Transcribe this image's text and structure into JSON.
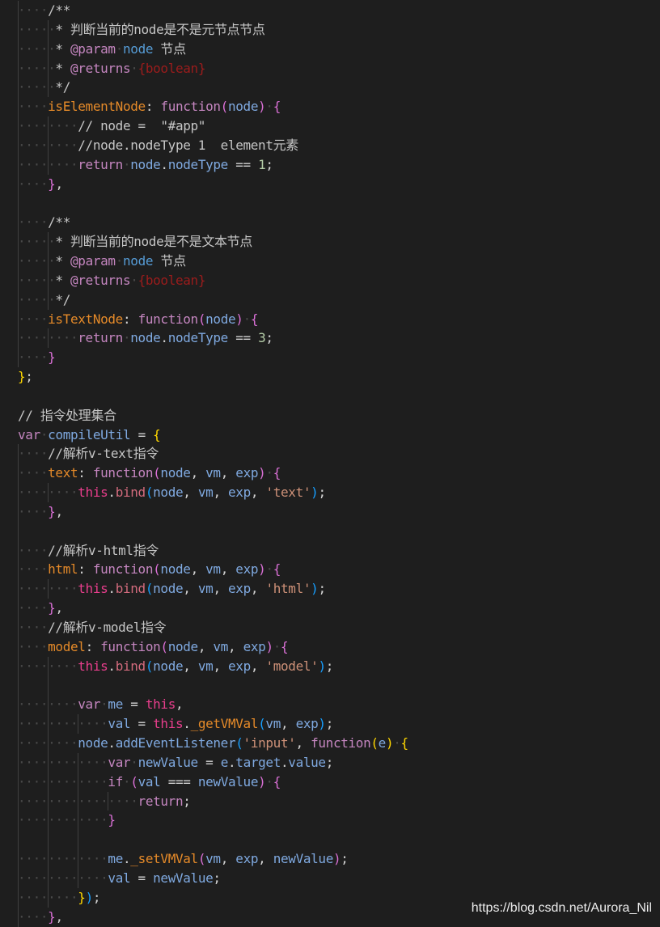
{
  "colors": {
    "background": "#1e1e1e",
    "comment": "#c6c6c6",
    "jsdoc_tag": "#c586c0",
    "jsdoc_type": "#9b1c1c",
    "param_name": "#569cd6",
    "property_key": "#e58a29",
    "keyword": "#c586c0",
    "function_kw": "#c586c0",
    "identifier": "#7fa9e0",
    "punct": "#d4d4d4",
    "number": "#b5cea8",
    "string": "#ce9178",
    "this": "#e83e8c",
    "method": "#d36b7d",
    "bracket_yellow": "#ffd700",
    "bracket_pink": "#da70d6",
    "bracket_blue": "#179fff",
    "whitespace": "#4a4a4a"
  },
  "lines": [
    [
      {
        "t": "    ",
        "c": "ws"
      },
      {
        "t": "/**",
        "c": "comment"
      }
    ],
    [
      {
        "t": "     ",
        "c": "ws"
      },
      {
        "t": "* 判断当前的node是不是元节点节点",
        "c": "comment"
      }
    ],
    [
      {
        "t": "     ",
        "c": "ws"
      },
      {
        "t": "* ",
        "c": "comment"
      },
      {
        "t": "@param",
        "c": "jsdoc_tag"
      },
      {
        "t": " ",
        "c": "ws"
      },
      {
        "t": "node",
        "c": "param_name"
      },
      {
        "t": " 节点",
        "c": "comment"
      }
    ],
    [
      {
        "t": "     ",
        "c": "ws"
      },
      {
        "t": "* ",
        "c": "comment"
      },
      {
        "t": "@returns",
        "c": "jsdoc_tag"
      },
      {
        "t": " ",
        "c": "ws"
      },
      {
        "t": "{boolean}",
        "c": "jsdoc_type"
      }
    ],
    [
      {
        "t": "     ",
        "c": "ws"
      },
      {
        "t": "*/",
        "c": "comment"
      }
    ],
    [
      {
        "t": "    ",
        "c": "ws"
      },
      {
        "t": "isElementNode",
        "c": "property_key"
      },
      {
        "t": ": ",
        "c": "punct"
      },
      {
        "t": "function",
        "c": "function_kw"
      },
      {
        "t": "(",
        "c": "bracket_pink"
      },
      {
        "t": "node",
        "c": "identifier"
      },
      {
        "t": ")",
        "c": "bracket_pink"
      },
      {
        "t": " ",
        "c": "ws"
      },
      {
        "t": "{",
        "c": "bracket_pink"
      }
    ],
    [
      {
        "t": "        ",
        "c": "ws"
      },
      {
        "t": "// node =  \"#app\"",
        "c": "comment"
      }
    ],
    [
      {
        "t": "        ",
        "c": "ws"
      },
      {
        "t": "//node.nodeType 1  element元素",
        "c": "comment"
      }
    ],
    [
      {
        "t": "        ",
        "c": "ws"
      },
      {
        "t": "return",
        "c": "keyword"
      },
      {
        "t": " ",
        "c": "ws"
      },
      {
        "t": "node",
        "c": "identifier"
      },
      {
        "t": ".",
        "c": "punct"
      },
      {
        "t": "nodeType",
        "c": "identifier"
      },
      {
        "t": " == ",
        "c": "punct"
      },
      {
        "t": "1",
        "c": "number"
      },
      {
        "t": ";",
        "c": "punct"
      }
    ],
    [
      {
        "t": "    ",
        "c": "ws"
      },
      {
        "t": "}",
        "c": "bracket_pink"
      },
      {
        "t": ",",
        "c": "punct"
      }
    ],
    [],
    [
      {
        "t": "    ",
        "c": "ws"
      },
      {
        "t": "/**",
        "c": "comment"
      }
    ],
    [
      {
        "t": "     ",
        "c": "ws"
      },
      {
        "t": "* 判断当前的node是不是文本节点",
        "c": "comment"
      }
    ],
    [
      {
        "t": "     ",
        "c": "ws"
      },
      {
        "t": "* ",
        "c": "comment"
      },
      {
        "t": "@param",
        "c": "jsdoc_tag"
      },
      {
        "t": " ",
        "c": "ws"
      },
      {
        "t": "node",
        "c": "param_name"
      },
      {
        "t": " 节点",
        "c": "comment"
      }
    ],
    [
      {
        "t": "     ",
        "c": "ws"
      },
      {
        "t": "* ",
        "c": "comment"
      },
      {
        "t": "@returns",
        "c": "jsdoc_tag"
      },
      {
        "t": " ",
        "c": "ws"
      },
      {
        "t": "{boolean}",
        "c": "jsdoc_type"
      }
    ],
    [
      {
        "t": "     ",
        "c": "ws"
      },
      {
        "t": "*/",
        "c": "comment"
      }
    ],
    [
      {
        "t": "    ",
        "c": "ws"
      },
      {
        "t": "isTextNode",
        "c": "property_key"
      },
      {
        "t": ": ",
        "c": "punct"
      },
      {
        "t": "function",
        "c": "function_kw"
      },
      {
        "t": "(",
        "c": "bracket_pink"
      },
      {
        "t": "node",
        "c": "identifier"
      },
      {
        "t": ")",
        "c": "bracket_pink"
      },
      {
        "t": " ",
        "c": "ws"
      },
      {
        "t": "{",
        "c": "bracket_pink"
      }
    ],
    [
      {
        "t": "        ",
        "c": "ws"
      },
      {
        "t": "return",
        "c": "keyword"
      },
      {
        "t": " ",
        "c": "ws"
      },
      {
        "t": "node",
        "c": "identifier"
      },
      {
        "t": ".",
        "c": "punct"
      },
      {
        "t": "nodeType",
        "c": "identifier"
      },
      {
        "t": " == ",
        "c": "punct"
      },
      {
        "t": "3",
        "c": "number"
      },
      {
        "t": ";",
        "c": "punct"
      }
    ],
    [
      {
        "t": "    ",
        "c": "ws"
      },
      {
        "t": "}",
        "c": "bracket_pink"
      }
    ],
    [
      {
        "t": "}",
        "c": "bracket_yellow"
      },
      {
        "t": ";",
        "c": "punct"
      }
    ],
    [],
    [
      {
        "t": "// 指令处理集合",
        "c": "comment"
      }
    ],
    [
      {
        "t": "var",
        "c": "keyword"
      },
      {
        "t": " ",
        "c": "ws"
      },
      {
        "t": "compileUtil",
        "c": "identifier"
      },
      {
        "t": " = ",
        "c": "punct"
      },
      {
        "t": "{",
        "c": "bracket_yellow"
      }
    ],
    [
      {
        "t": "    ",
        "c": "ws"
      },
      {
        "t": "//解析v-text指令",
        "c": "comment"
      }
    ],
    [
      {
        "t": "    ",
        "c": "ws"
      },
      {
        "t": "text",
        "c": "property_key"
      },
      {
        "t": ": ",
        "c": "punct"
      },
      {
        "t": "function",
        "c": "function_kw"
      },
      {
        "t": "(",
        "c": "bracket_pink"
      },
      {
        "t": "node",
        "c": "identifier"
      },
      {
        "t": ", ",
        "c": "punct"
      },
      {
        "t": "vm",
        "c": "identifier"
      },
      {
        "t": ", ",
        "c": "punct"
      },
      {
        "t": "exp",
        "c": "identifier"
      },
      {
        "t": ")",
        "c": "bracket_pink"
      },
      {
        "t": " ",
        "c": "ws"
      },
      {
        "t": "{",
        "c": "bracket_pink"
      }
    ],
    [
      {
        "t": "        ",
        "c": "ws"
      },
      {
        "t": "this",
        "c": "this"
      },
      {
        "t": ".",
        "c": "punct"
      },
      {
        "t": "bind",
        "c": "method"
      },
      {
        "t": "(",
        "c": "bracket_blue"
      },
      {
        "t": "node",
        "c": "identifier"
      },
      {
        "t": ", ",
        "c": "punct"
      },
      {
        "t": "vm",
        "c": "identifier"
      },
      {
        "t": ", ",
        "c": "punct"
      },
      {
        "t": "exp",
        "c": "identifier"
      },
      {
        "t": ", ",
        "c": "punct"
      },
      {
        "t": "'text'",
        "c": "string"
      },
      {
        "t": ")",
        "c": "bracket_blue"
      },
      {
        "t": ";",
        "c": "punct"
      }
    ],
    [
      {
        "t": "    ",
        "c": "ws"
      },
      {
        "t": "}",
        "c": "bracket_pink"
      },
      {
        "t": ",",
        "c": "punct"
      }
    ],
    [],
    [
      {
        "t": "    ",
        "c": "ws"
      },
      {
        "t": "//解析v-html指令",
        "c": "comment"
      }
    ],
    [
      {
        "t": "    ",
        "c": "ws"
      },
      {
        "t": "html",
        "c": "property_key"
      },
      {
        "t": ": ",
        "c": "punct"
      },
      {
        "t": "function",
        "c": "function_kw"
      },
      {
        "t": "(",
        "c": "bracket_pink"
      },
      {
        "t": "node",
        "c": "identifier"
      },
      {
        "t": ", ",
        "c": "punct"
      },
      {
        "t": "vm",
        "c": "identifier"
      },
      {
        "t": ", ",
        "c": "punct"
      },
      {
        "t": "exp",
        "c": "identifier"
      },
      {
        "t": ")",
        "c": "bracket_pink"
      },
      {
        "t": " ",
        "c": "ws"
      },
      {
        "t": "{",
        "c": "bracket_pink"
      }
    ],
    [
      {
        "t": "        ",
        "c": "ws"
      },
      {
        "t": "this",
        "c": "this"
      },
      {
        "t": ".",
        "c": "punct"
      },
      {
        "t": "bind",
        "c": "method"
      },
      {
        "t": "(",
        "c": "bracket_blue"
      },
      {
        "t": "node",
        "c": "identifier"
      },
      {
        "t": ", ",
        "c": "punct"
      },
      {
        "t": "vm",
        "c": "identifier"
      },
      {
        "t": ", ",
        "c": "punct"
      },
      {
        "t": "exp",
        "c": "identifier"
      },
      {
        "t": ", ",
        "c": "punct"
      },
      {
        "t": "'html'",
        "c": "string"
      },
      {
        "t": ")",
        "c": "bracket_blue"
      },
      {
        "t": ";",
        "c": "punct"
      }
    ],
    [
      {
        "t": "    ",
        "c": "ws"
      },
      {
        "t": "}",
        "c": "bracket_pink"
      },
      {
        "t": ",",
        "c": "punct"
      }
    ],
    [
      {
        "t": "    ",
        "c": "ws"
      },
      {
        "t": "//解析v-model指令",
        "c": "comment"
      }
    ],
    [
      {
        "t": "    ",
        "c": "ws"
      },
      {
        "t": "model",
        "c": "property_key"
      },
      {
        "t": ": ",
        "c": "punct"
      },
      {
        "t": "function",
        "c": "function_kw"
      },
      {
        "t": "(",
        "c": "bracket_pink"
      },
      {
        "t": "node",
        "c": "identifier"
      },
      {
        "t": ", ",
        "c": "punct"
      },
      {
        "t": "vm",
        "c": "identifier"
      },
      {
        "t": ", ",
        "c": "punct"
      },
      {
        "t": "exp",
        "c": "identifier"
      },
      {
        "t": ")",
        "c": "bracket_pink"
      },
      {
        "t": " ",
        "c": "ws"
      },
      {
        "t": "{",
        "c": "bracket_pink"
      }
    ],
    [
      {
        "t": "        ",
        "c": "ws"
      },
      {
        "t": "this",
        "c": "this"
      },
      {
        "t": ".",
        "c": "punct"
      },
      {
        "t": "bind",
        "c": "method"
      },
      {
        "t": "(",
        "c": "bracket_blue"
      },
      {
        "t": "node",
        "c": "identifier"
      },
      {
        "t": ", ",
        "c": "punct"
      },
      {
        "t": "vm",
        "c": "identifier"
      },
      {
        "t": ", ",
        "c": "punct"
      },
      {
        "t": "exp",
        "c": "identifier"
      },
      {
        "t": ", ",
        "c": "punct"
      },
      {
        "t": "'model'",
        "c": "string"
      },
      {
        "t": ")",
        "c": "bracket_blue"
      },
      {
        "t": ";",
        "c": "punct"
      }
    ],
    [],
    [
      {
        "t": "        ",
        "c": "ws"
      },
      {
        "t": "var",
        "c": "keyword"
      },
      {
        "t": " ",
        "c": "ws"
      },
      {
        "t": "me",
        "c": "identifier"
      },
      {
        "t": " = ",
        "c": "punct"
      },
      {
        "t": "this",
        "c": "this"
      },
      {
        "t": ",",
        "c": "punct"
      }
    ],
    [
      {
        "t": "            ",
        "c": "ws"
      },
      {
        "t": "val",
        "c": "identifier"
      },
      {
        "t": " = ",
        "c": "punct"
      },
      {
        "t": "this",
        "c": "this"
      },
      {
        "t": ".",
        "c": "punct"
      },
      {
        "t": "_getVMVal",
        "c": "property_key"
      },
      {
        "t": "(",
        "c": "bracket_blue"
      },
      {
        "t": "vm",
        "c": "identifier"
      },
      {
        "t": ", ",
        "c": "punct"
      },
      {
        "t": "exp",
        "c": "identifier"
      },
      {
        "t": ")",
        "c": "bracket_blue"
      },
      {
        "t": ";",
        "c": "punct"
      }
    ],
    [
      {
        "t": "        ",
        "c": "ws"
      },
      {
        "t": "node",
        "c": "identifier"
      },
      {
        "t": ".",
        "c": "punct"
      },
      {
        "t": "addEventListener",
        "c": "identifier"
      },
      {
        "t": "(",
        "c": "bracket_blue"
      },
      {
        "t": "'input'",
        "c": "string"
      },
      {
        "t": ", ",
        "c": "punct"
      },
      {
        "t": "function",
        "c": "function_kw"
      },
      {
        "t": "(",
        "c": "bracket_yellow"
      },
      {
        "t": "e",
        "c": "identifier"
      },
      {
        "t": ")",
        "c": "bracket_yellow"
      },
      {
        "t": " ",
        "c": "ws"
      },
      {
        "t": "{",
        "c": "bracket_yellow"
      }
    ],
    [
      {
        "t": "            ",
        "c": "ws"
      },
      {
        "t": "var",
        "c": "keyword"
      },
      {
        "t": " ",
        "c": "ws"
      },
      {
        "t": "newValue",
        "c": "identifier"
      },
      {
        "t": " = ",
        "c": "punct"
      },
      {
        "t": "e",
        "c": "identifier"
      },
      {
        "t": ".",
        "c": "punct"
      },
      {
        "t": "target",
        "c": "identifier"
      },
      {
        "t": ".",
        "c": "punct"
      },
      {
        "t": "value",
        "c": "identifier"
      },
      {
        "t": ";",
        "c": "punct"
      }
    ],
    [
      {
        "t": "            ",
        "c": "ws"
      },
      {
        "t": "if",
        "c": "keyword"
      },
      {
        "t": " ",
        "c": "ws"
      },
      {
        "t": "(",
        "c": "bracket_pink"
      },
      {
        "t": "val",
        "c": "identifier"
      },
      {
        "t": " === ",
        "c": "punct"
      },
      {
        "t": "newValue",
        "c": "identifier"
      },
      {
        "t": ")",
        "c": "bracket_pink"
      },
      {
        "t": " ",
        "c": "ws"
      },
      {
        "t": "{",
        "c": "bracket_pink"
      }
    ],
    [
      {
        "t": "                ",
        "c": "ws"
      },
      {
        "t": "return",
        "c": "keyword"
      },
      {
        "t": ";",
        "c": "punct"
      }
    ],
    [
      {
        "t": "            ",
        "c": "ws"
      },
      {
        "t": "}",
        "c": "bracket_pink"
      }
    ],
    [],
    [
      {
        "t": "            ",
        "c": "ws"
      },
      {
        "t": "me",
        "c": "identifier"
      },
      {
        "t": ".",
        "c": "punct"
      },
      {
        "t": "_setVMVal",
        "c": "property_key"
      },
      {
        "t": "(",
        "c": "bracket_pink"
      },
      {
        "t": "vm",
        "c": "identifier"
      },
      {
        "t": ", ",
        "c": "punct"
      },
      {
        "t": "exp",
        "c": "identifier"
      },
      {
        "t": ", ",
        "c": "punct"
      },
      {
        "t": "newValue",
        "c": "identifier"
      },
      {
        "t": ")",
        "c": "bracket_pink"
      },
      {
        "t": ";",
        "c": "punct"
      }
    ],
    [
      {
        "t": "            ",
        "c": "ws"
      },
      {
        "t": "val",
        "c": "identifier"
      },
      {
        "t": " = ",
        "c": "punct"
      },
      {
        "t": "newValue",
        "c": "identifier"
      },
      {
        "t": ";",
        "c": "punct"
      }
    ],
    [
      {
        "t": "        ",
        "c": "ws"
      },
      {
        "t": "}",
        "c": "bracket_yellow"
      },
      {
        "t": ")",
        "c": "bracket_blue"
      },
      {
        "t": ";",
        "c": "punct"
      }
    ],
    [
      {
        "t": "    ",
        "c": "ws"
      },
      {
        "t": "}",
        "c": "bracket_pink"
      },
      {
        "t": ",",
        "c": "punct"
      }
    ]
  ],
  "indent_guides": [
    [
      1
    ],
    [
      1,
      2
    ],
    [
      1,
      2
    ],
    [
      1,
      2
    ],
    [
      1,
      2
    ],
    [
      1
    ],
    [
      1,
      2
    ],
    [
      1,
      2
    ],
    [
      1,
      2
    ],
    [
      1
    ],
    [
      1
    ],
    [
      1
    ],
    [
      1,
      2
    ],
    [
      1,
      2
    ],
    [
      1,
      2
    ],
    [
      1,
      2
    ],
    [
      1
    ],
    [
      1,
      2
    ],
    [
      1
    ],
    [],
    [],
    [],
    [],
    [
      1
    ],
    [
      1
    ],
    [
      1,
      2
    ],
    [
      1
    ],
    [
      1
    ],
    [
      1
    ],
    [
      1
    ],
    [
      1,
      2
    ],
    [
      1
    ],
    [
      1
    ],
    [
      1
    ],
    [
      1,
      2
    ],
    [
      1,
      2
    ],
    [
      1,
      2
    ],
    [
      1,
      2,
      3
    ],
    [
      1,
      2
    ],
    [
      1,
      2,
      3
    ],
    [
      1,
      2,
      3
    ],
    [
      1,
      2,
      3,
      4
    ],
    [
      1,
      2,
      3
    ],
    [
      1,
      2,
      3
    ],
    [
      1,
      2,
      3
    ],
    [
      1,
      2,
      3
    ],
    [
      1,
      2
    ],
    [
      1
    ]
  ],
  "watermark": "https://blog.csdn.net/Aurora_Nil"
}
